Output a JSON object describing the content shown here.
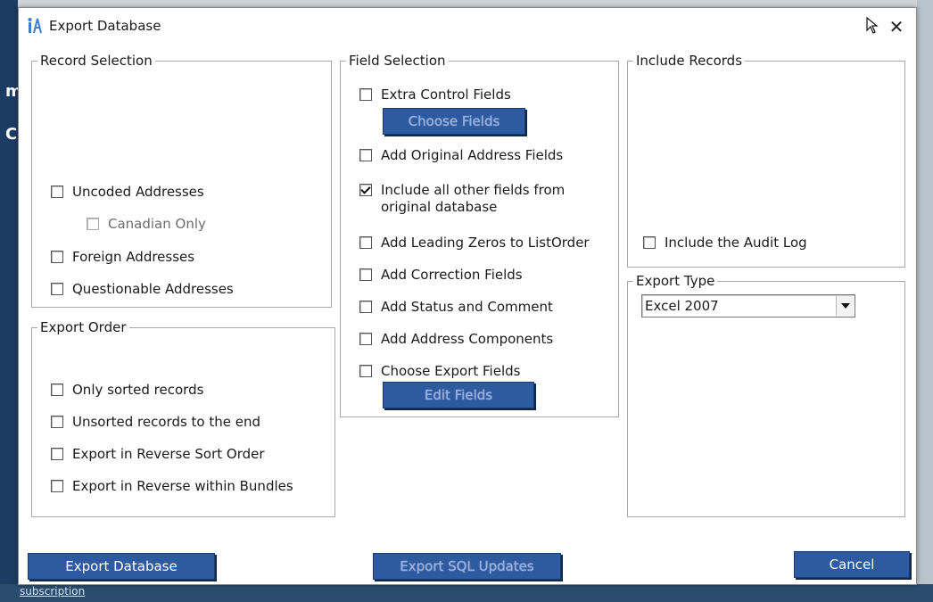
{
  "background": {
    "subscription_text": "subscription"
  },
  "window": {
    "title": "Export Database"
  },
  "record_selection": {
    "legend": "Record Selection",
    "uncoded": "Uncoded Addresses",
    "canadian": "Canadian Only",
    "foreign": "Foreign Addresses",
    "questionable": "Questionable Addresses"
  },
  "export_order": {
    "legend": "Export Order",
    "only_sorted": "Only sorted records",
    "unsorted_end": "Unsorted records to the end",
    "reverse_sort": "Export in Reverse Sort Order",
    "reverse_bundles": "Export in Reverse within Bundles"
  },
  "field_selection": {
    "legend": "Field Selection",
    "extra_control": "Extra Control Fields",
    "choose_fields": "Choose Fields",
    "add_original": "Add Original Address Fields",
    "include_all": "Include all other fields from original database",
    "leading_zeros": "Add Leading Zeros to ListOrder",
    "correction": "Add Correction Fields",
    "status_comment": "Add Status and Comment",
    "address_components": "Add Address Components",
    "choose_export": "Choose Export Fields",
    "edit_fields": "Edit Fields"
  },
  "include_records": {
    "legend": "Include Records",
    "audit_log": "Include the Audit Log"
  },
  "export_type": {
    "legend": "Export Type",
    "selected": "Excel 2007"
  },
  "buttons": {
    "export_database": "Export Database",
    "export_sql": "Export SQL Updates",
    "cancel": "Cancel"
  },
  "colors": {
    "button_bg": "#2e5aa0",
    "button_text": "#ffffff",
    "background_app": "#1d3c64"
  }
}
